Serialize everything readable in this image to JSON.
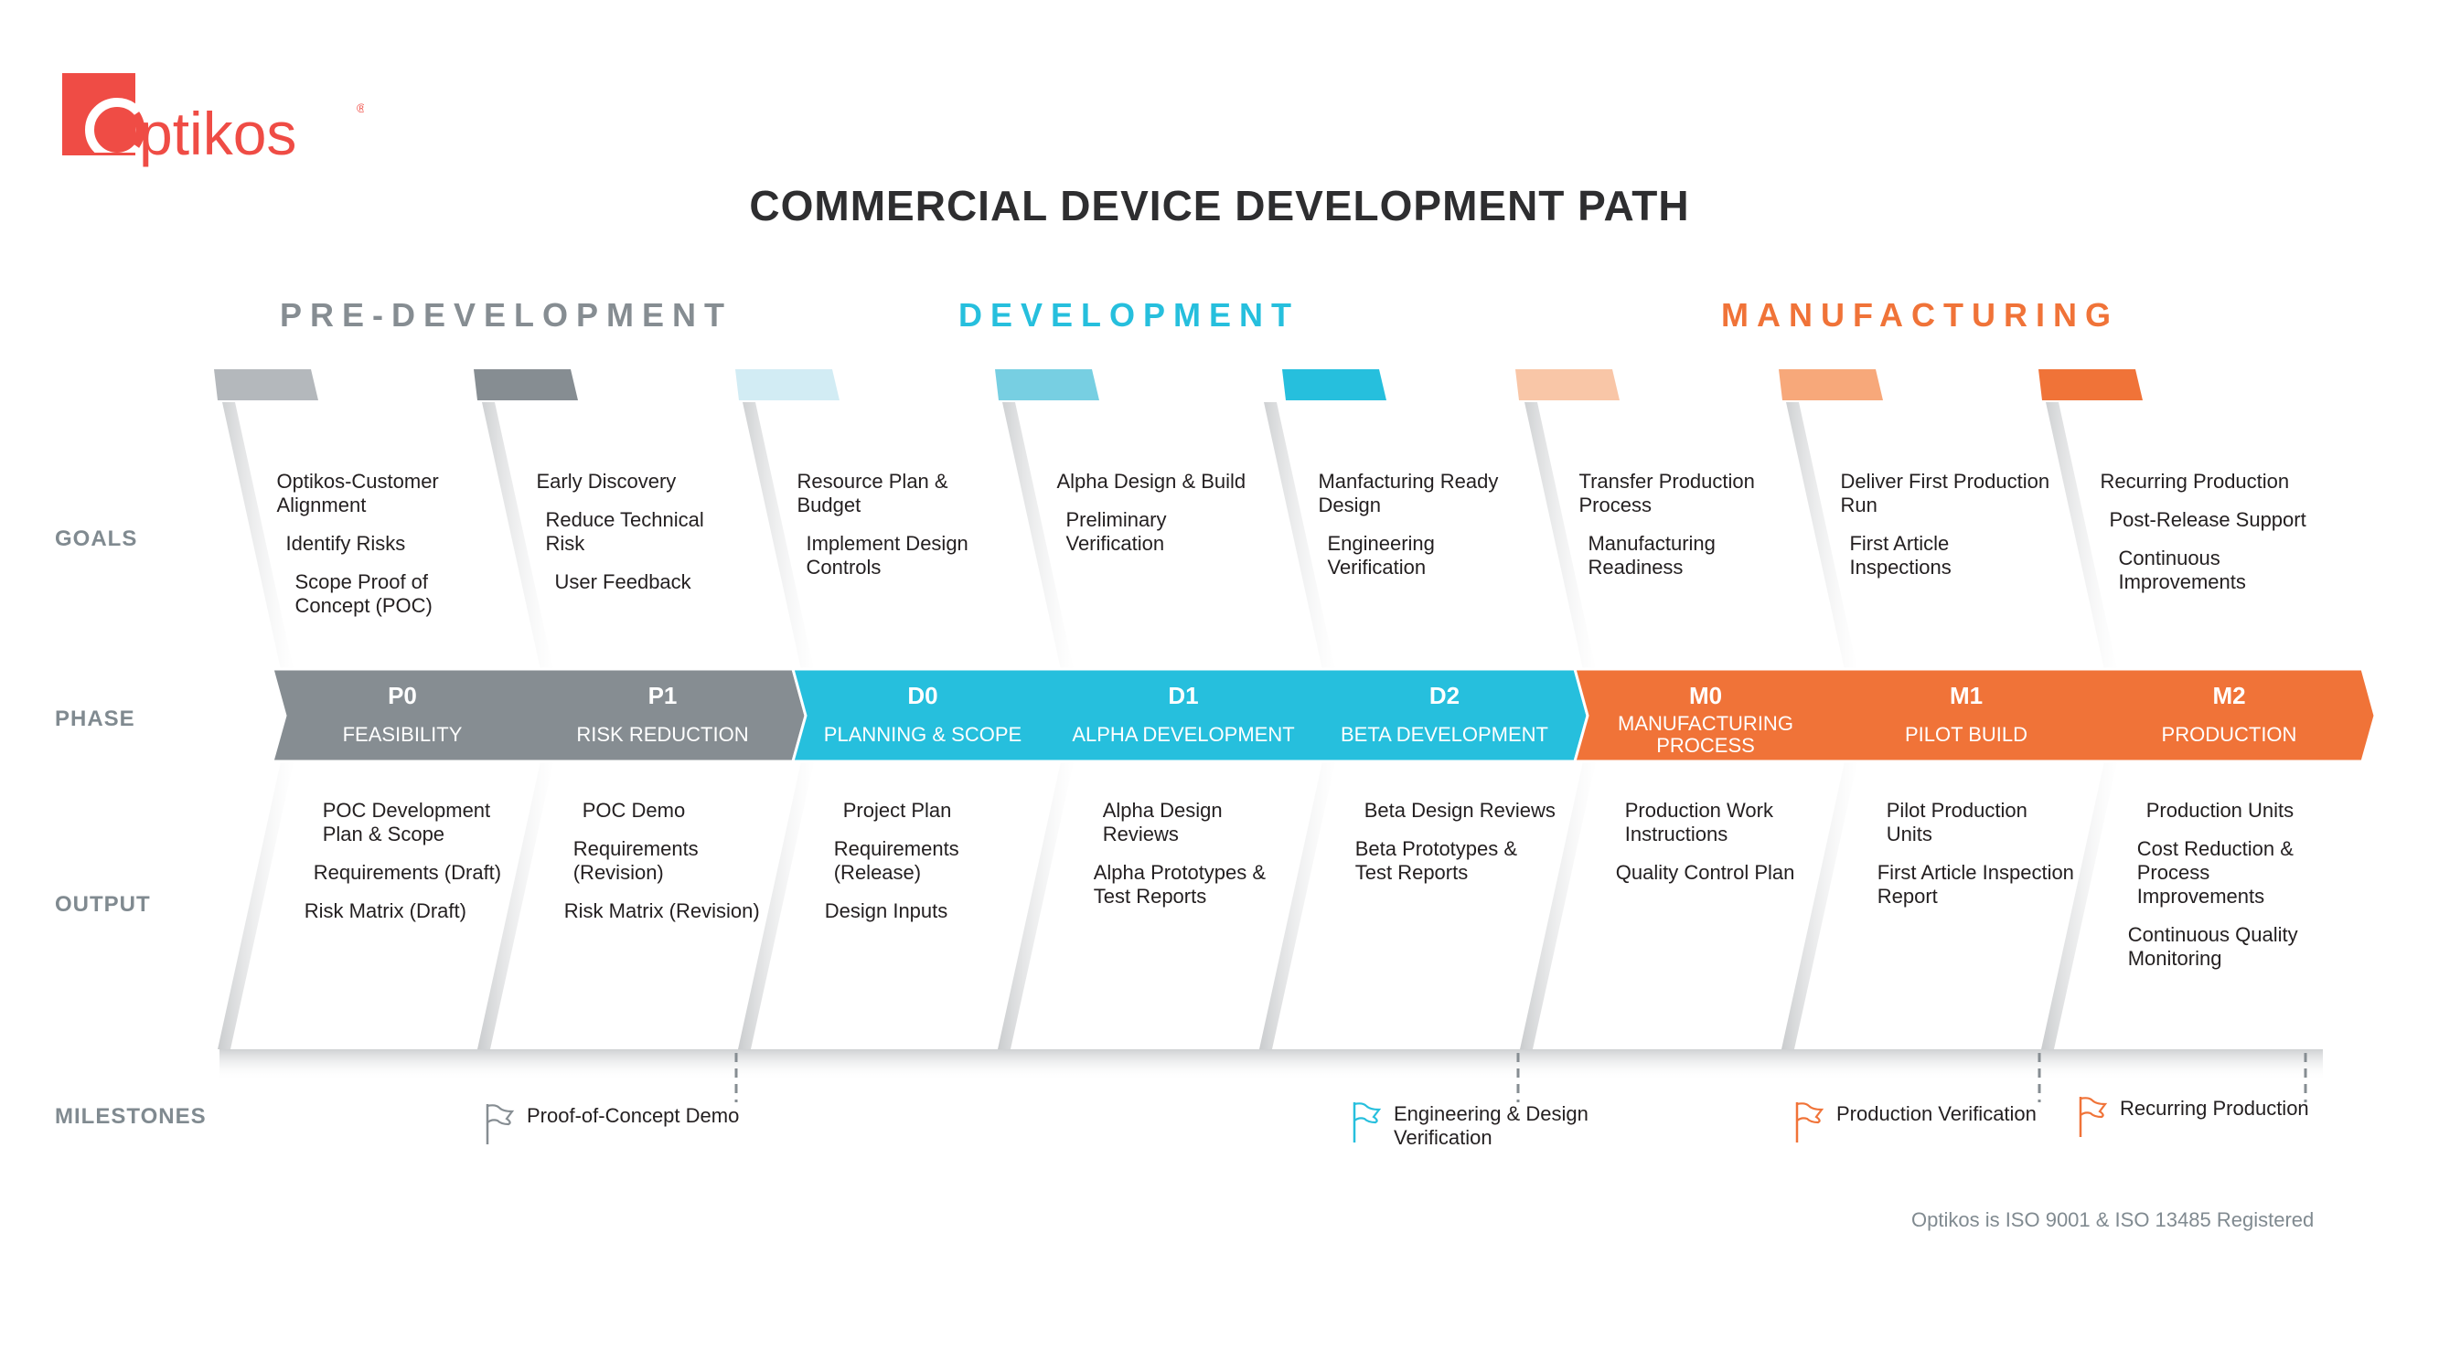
{
  "brand": {
    "name": "Optikos",
    "mark": "®",
    "color": "#ef4c45"
  },
  "title": "COMMERCIAL DEVICE DEVELOPMENT PATH",
  "sections": [
    {
      "label": "PRE-DEVELOPMENT",
      "color": "#868d92"
    },
    {
      "label": "DEVELOPMENT",
      "color": "#26bfdd"
    },
    {
      "label": "MANUFACTURING",
      "color": "#f07338"
    }
  ],
  "row_labels": {
    "goals": "GOALS",
    "phase": "PHASE",
    "output": "OUTPUT",
    "milestones": "MILESTONES"
  },
  "phases": [
    {
      "code": "P0",
      "name": "FEASIBILITY",
      "section": 0,
      "tab_color": "#b4b8bc",
      "goals": [
        "Optikos-Customer Alignment",
        "Identify Risks",
        "Scope Proof of Concept (POC)"
      ],
      "outputs": [
        "POC Development Plan & Scope",
        "Requirements (Draft)",
        "Risk Matrix (Draft)"
      ]
    },
    {
      "code": "P1",
      "name": "RISK REDUCTION",
      "section": 0,
      "tab_color": "#868d92",
      "goals": [
        "Early Discovery",
        "Reduce Technical Risk",
        "User Feedback"
      ],
      "outputs": [
        "POC Demo",
        "Requirements (Revision)",
        "Risk Matrix (Revision)"
      ]
    },
    {
      "code": "D0",
      "name": "PLANNING & SCOPE",
      "section": 1,
      "tab_color": "#d2ecf4",
      "goals": [
        "Resource Plan & Budget",
        "Implement Design Controls"
      ],
      "outputs": [
        "Project Plan",
        "Requirements (Release)",
        "Design Inputs"
      ]
    },
    {
      "code": "D1",
      "name": "ALPHA DEVELOPMENT",
      "section": 1,
      "tab_color": "#77cfe2",
      "goals": [
        "Alpha Design & Build",
        "Preliminary Verification"
      ],
      "outputs": [
        "Alpha Design Reviews",
        "Alpha Prototypes & Test Reports"
      ]
    },
    {
      "code": "D2",
      "name": "BETA DEVELOPMENT",
      "section": 1,
      "tab_color": "#26bfdd",
      "goals": [
        "Manfacturing Ready Design",
        "Engineering Verification"
      ],
      "outputs": [
        "Beta Design Reviews",
        "Beta Prototypes & Test Reports"
      ]
    },
    {
      "code": "M0",
      "name": "MANUFACTURING PROCESS",
      "section": 2,
      "tab_color": "#f9c6a7",
      "goals": [
        "Transfer Production Process",
        "Manufacturing Readiness"
      ],
      "outputs": [
        "Production Work Instructions",
        "Quality Control Plan"
      ]
    },
    {
      "code": "M1",
      "name": "PILOT BUILD",
      "section": 2,
      "tab_color": "#f7a87a",
      "goals": [
        "Deliver First Production Run",
        "First Article Inspections"
      ],
      "outputs": [
        "Pilot Production Units",
        "First Article Inspection Report"
      ]
    },
    {
      "code": "M2",
      "name": "PRODUCTION",
      "section": 2,
      "tab_color": "#f07338",
      "goals": [
        "Recurring Production",
        "Post-Release Support",
        "Continuous Improvements"
      ],
      "outputs": [
        "Production Units",
        "Cost Reduction & Process Improvements",
        "Continuous Quality Monitoring"
      ]
    }
  ],
  "milestones": [
    {
      "label": "Proof-of-Concept Demo",
      "icon": "flag-icon",
      "color": "#868d92",
      "after_phase": "P1"
    },
    {
      "label": "Engineering & Design Verification",
      "icon": "flag-icon",
      "color": "#26bfdd",
      "after_phase": "D2"
    },
    {
      "label": "Production Verification",
      "icon": "flag-icon",
      "color": "#f07338",
      "after_phase": "M1"
    },
    {
      "label": "Recurring Production",
      "icon": "flag-icon",
      "color": "#f07338",
      "after_phase": "M2"
    }
  ],
  "footer": "Optikos is ISO 9001 & ISO 13485 Registered"
}
